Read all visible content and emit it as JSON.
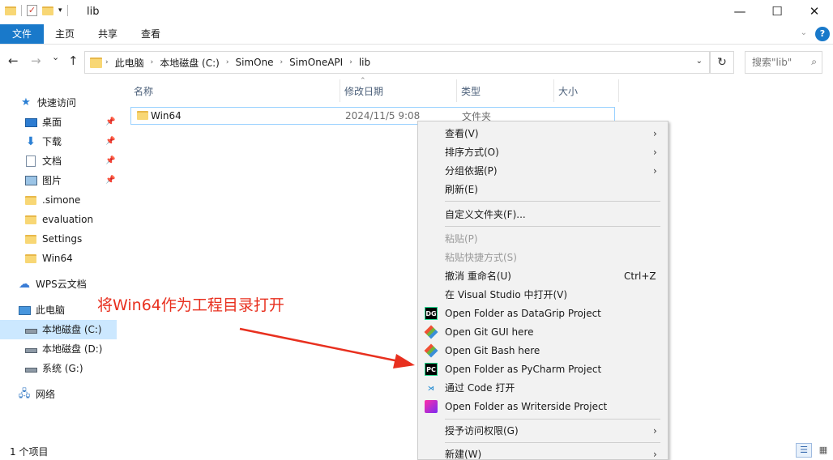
{
  "window": {
    "title": "lib",
    "minimize": "—",
    "maximize": "☐",
    "close": "✕"
  },
  "ribbon": {
    "tabs": [
      "文件",
      "主页",
      "共享",
      "查看"
    ],
    "expand": "⌄",
    "help": "?"
  },
  "nav": {
    "back": "←",
    "forward": "→",
    "recent": "⌄",
    "up": "↑",
    "breadcrumb": [
      "此电脑",
      "本地磁盘 (C:)",
      "SimOne",
      "SimOneAPI",
      "lib"
    ],
    "refresh": "↻",
    "search_placeholder": "搜索\"lib\""
  },
  "sidebar": {
    "items": [
      {
        "label": "快速访问",
        "icon": "star-icon"
      },
      {
        "label": "桌面",
        "icon": "desktop-icon",
        "pinned": true
      },
      {
        "label": "下载",
        "icon": "download-icon",
        "pinned": true
      },
      {
        "label": "文档",
        "icon": "document-icon",
        "pinned": true
      },
      {
        "label": "图片",
        "icon": "picture-icon",
        "pinned": true
      },
      {
        "label": ".simone",
        "icon": "folder-icon"
      },
      {
        "label": "evaluation",
        "icon": "folder-icon"
      },
      {
        "label": "Settings",
        "icon": "folder-icon"
      },
      {
        "label": "Win64",
        "icon": "folder-icon"
      },
      {
        "label": "WPS云文档",
        "icon": "cloud-icon"
      },
      {
        "label": "此电脑",
        "icon": "computer-icon"
      },
      {
        "label": "本地磁盘 (C:)",
        "icon": "drive-icon",
        "selected": true
      },
      {
        "label": "本地磁盘 (D:)",
        "icon": "drive-icon"
      },
      {
        "label": "系统 (G:)",
        "icon": "drive-icon"
      },
      {
        "label": "网络",
        "icon": "network-icon"
      }
    ]
  },
  "filelist": {
    "columns": [
      "名称",
      "修改日期",
      "类型",
      "大小"
    ],
    "rows": [
      {
        "name": "Win64",
        "modified": "2024/11/5 9:08",
        "type": "文件夹",
        "size": ""
      }
    ]
  },
  "status": {
    "count": "1 个项目"
  },
  "annotation": {
    "text": "将Win64作为工程目录打开",
    "color": "#e8301f"
  },
  "context_menu": {
    "items": [
      {
        "label": "查看(V)",
        "submenu": true
      },
      {
        "label": "排序方式(O)",
        "submenu": true
      },
      {
        "label": "分组依据(P)",
        "submenu": true
      },
      {
        "label": "刷新(E)"
      },
      {
        "label": "自定义文件夹(F)..."
      },
      {
        "label": "粘贴(P)",
        "disabled": true
      },
      {
        "label": "粘贴快捷方式(S)",
        "disabled": true
      },
      {
        "label": "撤消 重命名(U)",
        "shortcut": "Ctrl+Z"
      },
      {
        "label": "在 Visual Studio 中打开(V)"
      },
      {
        "label": "Open Folder as DataGrip Project",
        "icon": "datagrip-icon",
        "icon_text": "DG"
      },
      {
        "label": "Open Git GUI here",
        "icon": "git-gui-icon"
      },
      {
        "label": "Open Git Bash here",
        "icon": "git-bash-icon"
      },
      {
        "label": "Open Folder as PyCharm Project",
        "icon": "pycharm-icon",
        "icon_text": "PC"
      },
      {
        "label": "通过 Code 打开",
        "icon": "vscode-icon"
      },
      {
        "label": "Open Folder as Writerside Project",
        "icon": "writerside-icon"
      },
      {
        "label": "授予访问权限(G)",
        "submenu": true
      },
      {
        "label": "新建(W)",
        "submenu": true
      }
    ],
    "submenu_arrow": "›"
  }
}
